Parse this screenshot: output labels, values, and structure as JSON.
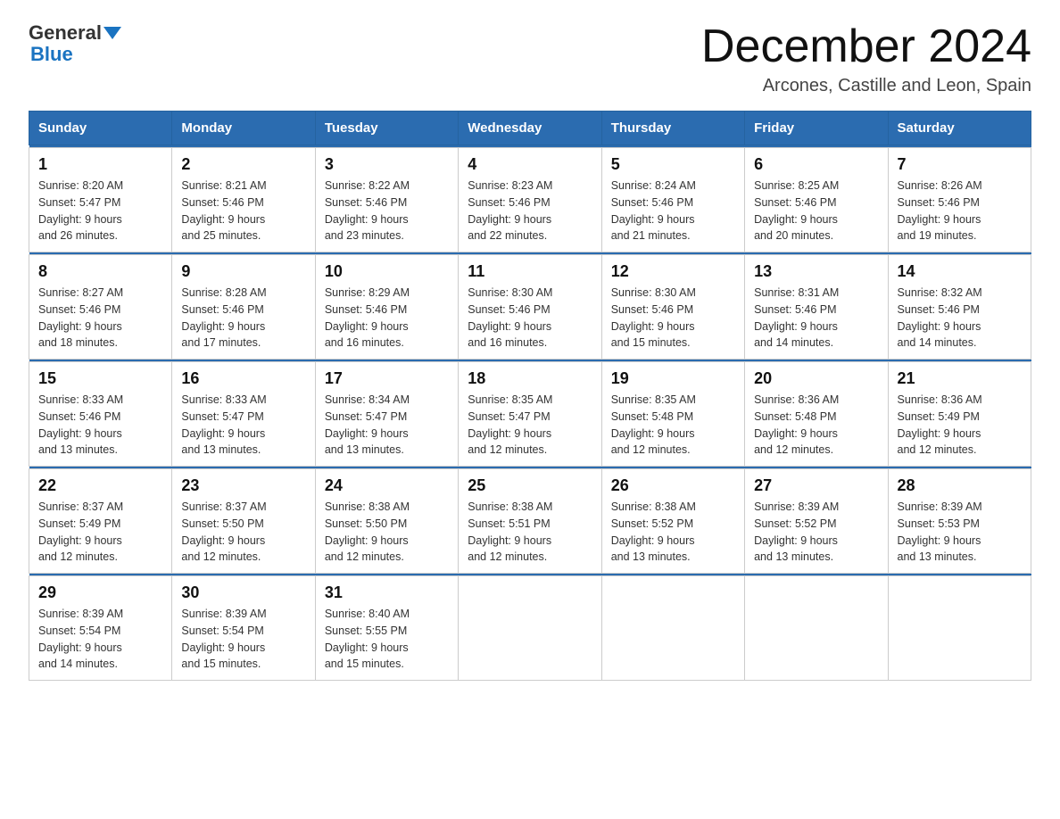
{
  "logo": {
    "text_general": "General",
    "text_blue": "Blue"
  },
  "header": {
    "month_title": "December 2024",
    "subtitle": "Arcones, Castille and Leon, Spain"
  },
  "weekdays": [
    "Sunday",
    "Monday",
    "Tuesday",
    "Wednesday",
    "Thursday",
    "Friday",
    "Saturday"
  ],
  "weeks": [
    [
      {
        "day": "1",
        "sunrise": "8:20 AM",
        "sunset": "5:47 PM",
        "daylight": "9 hours and 26 minutes."
      },
      {
        "day": "2",
        "sunrise": "8:21 AM",
        "sunset": "5:46 PM",
        "daylight": "9 hours and 25 minutes."
      },
      {
        "day": "3",
        "sunrise": "8:22 AM",
        "sunset": "5:46 PM",
        "daylight": "9 hours and 23 minutes."
      },
      {
        "day": "4",
        "sunrise": "8:23 AM",
        "sunset": "5:46 PM",
        "daylight": "9 hours and 22 minutes."
      },
      {
        "day": "5",
        "sunrise": "8:24 AM",
        "sunset": "5:46 PM",
        "daylight": "9 hours and 21 minutes."
      },
      {
        "day": "6",
        "sunrise": "8:25 AM",
        "sunset": "5:46 PM",
        "daylight": "9 hours and 20 minutes."
      },
      {
        "day": "7",
        "sunrise": "8:26 AM",
        "sunset": "5:46 PM",
        "daylight": "9 hours and 19 minutes."
      }
    ],
    [
      {
        "day": "8",
        "sunrise": "8:27 AM",
        "sunset": "5:46 PM",
        "daylight": "9 hours and 18 minutes."
      },
      {
        "day": "9",
        "sunrise": "8:28 AM",
        "sunset": "5:46 PM",
        "daylight": "9 hours and 17 minutes."
      },
      {
        "day": "10",
        "sunrise": "8:29 AM",
        "sunset": "5:46 PM",
        "daylight": "9 hours and 16 minutes."
      },
      {
        "day": "11",
        "sunrise": "8:30 AM",
        "sunset": "5:46 PM",
        "daylight": "9 hours and 16 minutes."
      },
      {
        "day": "12",
        "sunrise": "8:30 AM",
        "sunset": "5:46 PM",
        "daylight": "9 hours and 15 minutes."
      },
      {
        "day": "13",
        "sunrise": "8:31 AM",
        "sunset": "5:46 PM",
        "daylight": "9 hours and 14 minutes."
      },
      {
        "day": "14",
        "sunrise": "8:32 AM",
        "sunset": "5:46 PM",
        "daylight": "9 hours and 14 minutes."
      }
    ],
    [
      {
        "day": "15",
        "sunrise": "8:33 AM",
        "sunset": "5:46 PM",
        "daylight": "9 hours and 13 minutes."
      },
      {
        "day": "16",
        "sunrise": "8:33 AM",
        "sunset": "5:47 PM",
        "daylight": "9 hours and 13 minutes."
      },
      {
        "day": "17",
        "sunrise": "8:34 AM",
        "sunset": "5:47 PM",
        "daylight": "9 hours and 13 minutes."
      },
      {
        "day": "18",
        "sunrise": "8:35 AM",
        "sunset": "5:47 PM",
        "daylight": "9 hours and 12 minutes."
      },
      {
        "day": "19",
        "sunrise": "8:35 AM",
        "sunset": "5:48 PM",
        "daylight": "9 hours and 12 minutes."
      },
      {
        "day": "20",
        "sunrise": "8:36 AM",
        "sunset": "5:48 PM",
        "daylight": "9 hours and 12 minutes."
      },
      {
        "day": "21",
        "sunrise": "8:36 AM",
        "sunset": "5:49 PM",
        "daylight": "9 hours and 12 minutes."
      }
    ],
    [
      {
        "day": "22",
        "sunrise": "8:37 AM",
        "sunset": "5:49 PM",
        "daylight": "9 hours and 12 minutes."
      },
      {
        "day": "23",
        "sunrise": "8:37 AM",
        "sunset": "5:50 PM",
        "daylight": "9 hours and 12 minutes."
      },
      {
        "day": "24",
        "sunrise": "8:38 AM",
        "sunset": "5:50 PM",
        "daylight": "9 hours and 12 minutes."
      },
      {
        "day": "25",
        "sunrise": "8:38 AM",
        "sunset": "5:51 PM",
        "daylight": "9 hours and 12 minutes."
      },
      {
        "day": "26",
        "sunrise": "8:38 AM",
        "sunset": "5:52 PM",
        "daylight": "9 hours and 13 minutes."
      },
      {
        "day": "27",
        "sunrise": "8:39 AM",
        "sunset": "5:52 PM",
        "daylight": "9 hours and 13 minutes."
      },
      {
        "day": "28",
        "sunrise": "8:39 AM",
        "sunset": "5:53 PM",
        "daylight": "9 hours and 13 minutes."
      }
    ],
    [
      {
        "day": "29",
        "sunrise": "8:39 AM",
        "sunset": "5:54 PM",
        "daylight": "9 hours and 14 minutes."
      },
      {
        "day": "30",
        "sunrise": "8:39 AM",
        "sunset": "5:54 PM",
        "daylight": "9 hours and 15 minutes."
      },
      {
        "day": "31",
        "sunrise": "8:40 AM",
        "sunset": "5:55 PM",
        "daylight": "9 hours and 15 minutes."
      },
      null,
      null,
      null,
      null
    ]
  ],
  "labels": {
    "sunrise": "Sunrise:",
    "sunset": "Sunset:",
    "daylight": "Daylight:"
  }
}
